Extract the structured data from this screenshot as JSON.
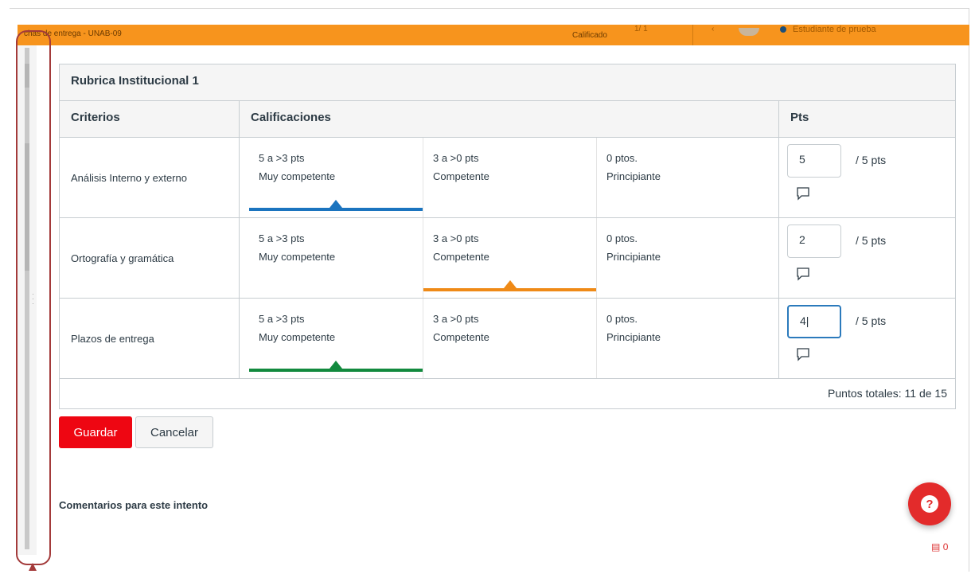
{
  "topbar": {
    "breadcrumb": "chas de entrega - UNAB-09",
    "status": "Calificado",
    "count": "1/ 1",
    "student_label": "Estudiante de prueba"
  },
  "rubric": {
    "title": "Rubrica Institucional 1",
    "headers": {
      "criteria": "Criterios",
      "ratings": "Calificaciones",
      "points": "Pts"
    },
    "rows": [
      {
        "criterion": "Análisis Interno y externo",
        "ratings": [
          {
            "pts": "5 a >3 pts",
            "desc": "Muy competente"
          },
          {
            "pts": "3 a >0 pts",
            "desc": "Competente"
          },
          {
            "pts": "0 ptos.",
            "desc": "Principiante"
          }
        ],
        "selected_index": 0,
        "selected_color": "#1b74bf",
        "score": "5",
        "out_of": "/ 5 pts"
      },
      {
        "criterion": "Ortografía y gramática",
        "ratings": [
          {
            "pts": "5 a >3 pts",
            "desc": "Muy competente"
          },
          {
            "pts": "3 a >0 pts",
            "desc": "Competente"
          },
          {
            "pts": "0 ptos.",
            "desc": "Principiante"
          }
        ],
        "selected_index": 1,
        "selected_color": "#ef8a17",
        "score": "2",
        "out_of": "/ 5 pts"
      },
      {
        "criterion": "Plazos de entrega",
        "ratings": [
          {
            "pts": "5 a >3 pts",
            "desc": "Muy competente"
          },
          {
            "pts": "3 a >0 pts",
            "desc": "Competente"
          },
          {
            "pts": "0 ptos.",
            "desc": "Principiante"
          }
        ],
        "selected_index": 0,
        "selected_color": "#128a3e",
        "score": "4|",
        "out_of": "/ 5 pts"
      }
    ],
    "total": "Puntos totales: 11 de 15"
  },
  "actions": {
    "save": "Guardar",
    "cancel": "Cancelar"
  },
  "comments_label": "Comentarios para este intento",
  "bottom_badge": "0",
  "colors": {
    "accent_orange": "#f7941d",
    "save_red": "#ee0612",
    "help_red": "#e32b2b"
  },
  "icons": {
    "help": "question-circle-icon",
    "comment": "speech-bubble-icon"
  }
}
